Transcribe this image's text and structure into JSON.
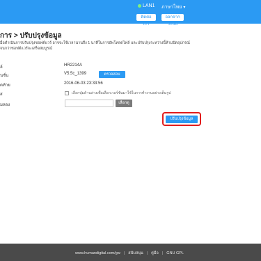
{
  "header": {
    "lan_label": "LAN1",
    "language_label": "ภาษาไทย",
    "contact_button": "ติดต่อเรา",
    "logout_button": "ออกจากระบบ"
  },
  "page": {
    "title": "การ > ปรับปรุงข้อมูล",
    "description": "มื่อดำเนินการปรับปรุงซอฟต์แวร์ อาจจะใช้เวลานานถึง 1 นาทีในการอัพโหลดไฟล์ และปรับปรุงระหว่างนี้ห้ามปิดอุปกรณ์จนกว่าซอฟต์แวร์จะเสร็จสมบูรณ์"
  },
  "rows": [
    {
      "label": "ล์",
      "value": "HR2214A"
    },
    {
      "label": "นชั่น",
      "value": "V5.5c_1399"
    },
    {
      "label": "ดท้าย",
      "value": "2016-06-03 23:33:56"
    },
    {
      "label": "ส",
      "value": ""
    },
    {
      "label": "มลอง",
      "value": ""
    }
  ],
  "check_button": "ตรวจสอบ",
  "checkbox_label": "เลือกปุ่มด้านล่างเพื่อเลือกเวอร์ชันมาใช้ในการทำงานอย่างเต็มรูป",
  "file_input_value": "",
  "browse_button": "เลือกดู",
  "upgrade_button": "ปรับปรุงข้อมูล",
  "footer": {
    "website": "www.humandigital.com/gw",
    "link1": "สนับสนุน",
    "link2": "คู่มือ",
    "link3": "GNU GPL"
  },
  "colors": {
    "accent": "#2b9af3",
    "highlight": "#e11c1c",
    "footer_bg": "#4a4a4a"
  }
}
